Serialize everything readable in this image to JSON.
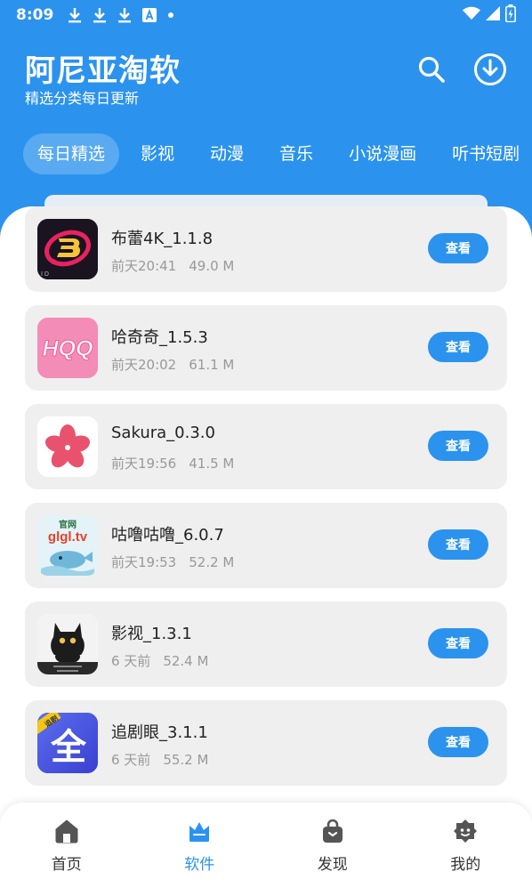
{
  "status_bar": {
    "time": "8:09",
    "icons": [
      "download-icon",
      "download-icon",
      "download-icon",
      "a-box-icon",
      "dot-icon"
    ],
    "right_icons": [
      "wifi-icon",
      "signal-icon",
      "battery-icon"
    ]
  },
  "header": {
    "title": "阿尼亚淘软",
    "subtitle": "精选分类每日更新",
    "buttons": [
      "search-icon",
      "download-circle-icon"
    ]
  },
  "tabs": [
    {
      "label": "每日精选",
      "active": true
    },
    {
      "label": "影视"
    },
    {
      "label": "动漫"
    },
    {
      "label": "音乐"
    },
    {
      "label": "小说漫画"
    },
    {
      "label": "听书短剧"
    }
  ],
  "apps": [
    {
      "name": "布蕾4K_1.1.8",
      "time": "前天20:41",
      "size": "49.0 M",
      "button": "查看",
      "icon": "bulei-app-icon"
    },
    {
      "name": "哈奇奇_1.5.3",
      "time": "前天20:02",
      "size": "61.1 M",
      "button": "查看",
      "icon": "hqq-app-icon",
      "icon_text": "HQQ"
    },
    {
      "name": "Sakura_0.3.0",
      "time": "前天19:56",
      "size": "41.5 M",
      "button": "查看",
      "icon": "sakura-app-icon"
    },
    {
      "name": "咕噜咕噜_6.0.7",
      "time": "前天19:53",
      "size": "52.2 M",
      "button": "查看",
      "icon": "glgl-app-icon",
      "icon_text_top": "官网",
      "icon_text": "glgl.tv"
    },
    {
      "name": "影视_1.3.1",
      "time": "6 天前",
      "size": "52.4 M",
      "button": "查看",
      "icon": "black-cat-app-icon"
    },
    {
      "name": "追剧眼_3.1.1",
      "time": "6 天前",
      "size": "55.2 M",
      "button": "查看",
      "icon": "zhuijuyan-app-icon",
      "icon_badge": "追剧",
      "icon_text": "全"
    }
  ],
  "bottom_nav": [
    {
      "label": "首页",
      "icon": "home-icon"
    },
    {
      "label": "软件",
      "icon": "crown-icon",
      "active": true
    },
    {
      "label": "发现",
      "icon": "bag-icon"
    },
    {
      "label": "我的",
      "icon": "profile-icon"
    }
  ],
  "colors": {
    "primary": "#2b93ee",
    "card": "#efefef",
    "meta": "#999999"
  }
}
